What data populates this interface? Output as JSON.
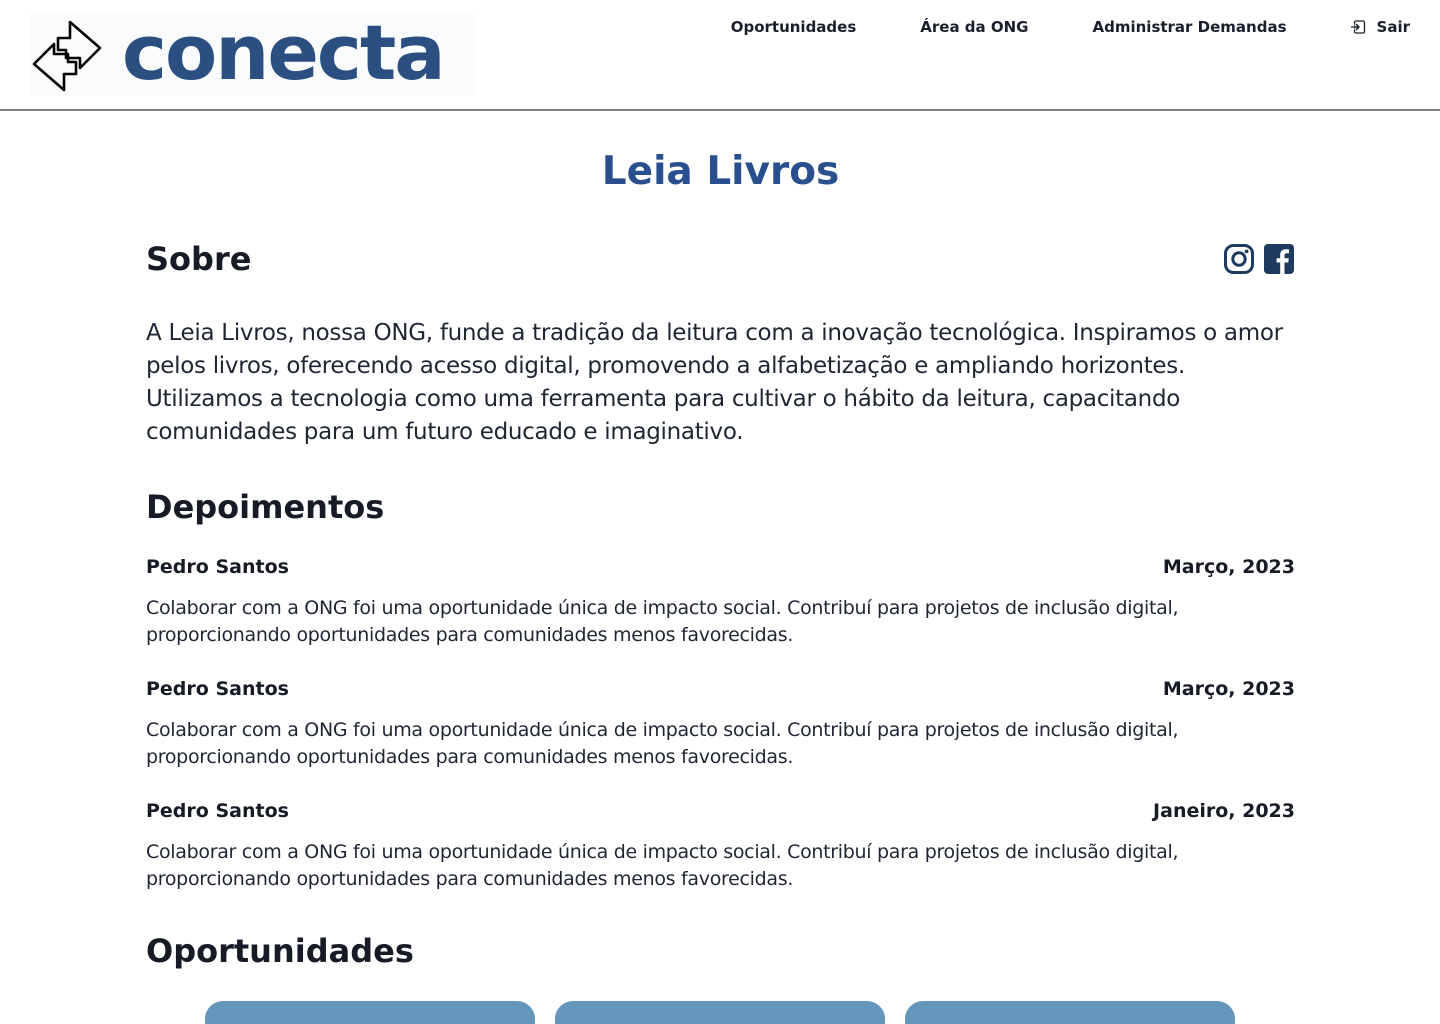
{
  "brand": {
    "name": "conecta",
    "color": "#2a4f80"
  },
  "nav": {
    "items": [
      "Oportunidades",
      "Área da ONG",
      "Administrar Demandas"
    ],
    "logout": "Sair"
  },
  "page": {
    "title": "Leia Livros",
    "about_heading": "Sobre",
    "about_text": "A Leia Livros, nossa ONG, funde a tradição da leitura com a inovação tecnológica. Inspiramos o amor pelos livros, oferecendo acesso digital, promovendo a alfabetização e ampliando horizontes. Utilizamos a tecnologia como uma ferramenta para cultivar o hábito da leitura, capacitando comunidades para um futuro educado e imaginativo.",
    "social_icons": [
      "instagram-icon",
      "facebook-icon"
    ],
    "testimonials_heading": "Depoimentos",
    "testimonials": [
      {
        "author": "Pedro Santos",
        "date": "Março, 2023",
        "text": "Colaborar com a ONG foi uma oportunidade única de impacto social. Contribuí para projetos de inclusão digital, proporcionando oportunidades para comunidades menos favorecidas."
      },
      {
        "author": "Pedro Santos",
        "date": "Março, 2023",
        "text": "Colaborar com a ONG foi uma oportunidade única de impacto social. Contribuí para projetos de inclusão digital, proporcionando oportunidades para comunidades menos favorecidas."
      },
      {
        "author": "Pedro Santos",
        "date": "Janeiro, 2023",
        "text": "Colaborar com a ONG foi uma oportunidade única de impacto social. Contribuí para projetos de inclusão digital, proporcionando oportunidades para comunidades menos favorecidas."
      }
    ],
    "opportunities_heading": "Oportunidades",
    "opportunity_card_color": "#6497bb"
  }
}
